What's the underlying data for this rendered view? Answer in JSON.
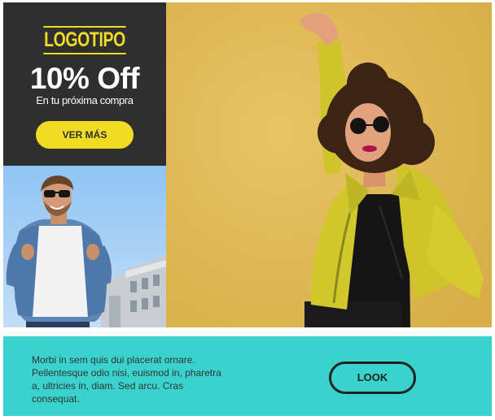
{
  "promo": {
    "logo": "LOGOTIPO",
    "discount": "10% Off",
    "subtitle": "En tu próxima compra",
    "cta_label": "VER MÁS"
  },
  "images": {
    "man": "man-sunglasses-denim-jacket-photo",
    "woman": "woman-yellow-leather-jacket-photo"
  },
  "footer": {
    "text": "Morbi in sem quis dui placerat ornare. Pellentesque odio nisi, euismod in, pharetra a, ultricies in, diam. Sed arcu. Cras consequat.",
    "button_label": "LOOK"
  },
  "colors": {
    "dark_panel": "#2f2f2f",
    "accent_yellow": "#f0dc24",
    "footer_teal": "#3ad2cc",
    "text_dark": "#333333"
  }
}
